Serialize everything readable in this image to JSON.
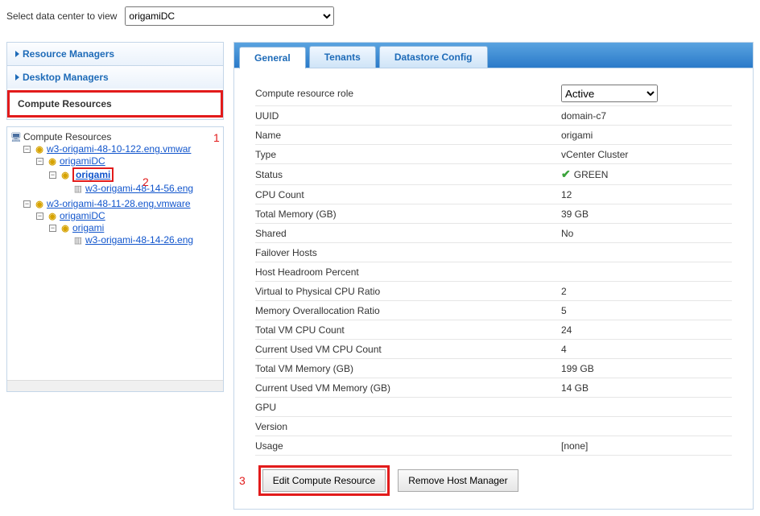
{
  "top": {
    "label": "Select data center to view",
    "selected": "origamiDC"
  },
  "nav": {
    "resource_managers": "Resource Managers",
    "desktop_managers": "Desktop Managers",
    "compute_resources": "Compute Resources"
  },
  "annotations": {
    "a1": "1",
    "a2": "2",
    "a3": "3"
  },
  "tree": {
    "root": "Compute Resources",
    "n1": "w3-origami-48-10-122.eng.vmwar",
    "n1_dc": "origamiDC",
    "n1_cl": "origami",
    "n1_host": "w3-origami-48-14-56.eng",
    "n2": "w3-origami-48-11-28.eng.vmware",
    "n2_dc": "origamiDC",
    "n2_cl": "origami",
    "n2_host": "w3-origami-48-14-26.eng"
  },
  "tabs": {
    "general": "General",
    "tenants": "Tenants",
    "datastore": "Datastore Config"
  },
  "details": {
    "role_label": "Compute resource role",
    "role_value": "Active",
    "uuid_label": "UUID",
    "uuid_value": "domain-c7",
    "name_label": "Name",
    "name_value": "origami",
    "type_label": "Type",
    "type_value": "vCenter Cluster",
    "status_label": "Status",
    "status_value": "GREEN",
    "cpu_count_label": "CPU Count",
    "cpu_count_value": "12",
    "total_mem_label": "Total Memory (GB)",
    "total_mem_value": "39 GB",
    "shared_label": "Shared",
    "shared_value": "No",
    "failover_label": "Failover Hosts",
    "failover_value": "",
    "headroom_label": "Host Headroom Percent",
    "headroom_value": "",
    "vpcpu_label": "Virtual to Physical CPU Ratio",
    "vpcpu_value": "2",
    "memover_label": "Memory Overallocation Ratio",
    "memover_value": "5",
    "tvm_cpu_label": "Total VM CPU Count",
    "tvm_cpu_value": "24",
    "cvm_cpu_label": "Current Used VM CPU Count",
    "cvm_cpu_value": "4",
    "tvm_mem_label": "Total VM Memory (GB)",
    "tvm_mem_value": "199 GB",
    "cvm_mem_label": "Current Used VM Memory (GB)",
    "cvm_mem_value": "14 GB",
    "gpu_label": "GPU",
    "gpu_value": "",
    "version_label": "Version",
    "version_value": "",
    "usage_label": "Usage",
    "usage_value": "[none]"
  },
  "buttons": {
    "edit": "Edit Compute Resource",
    "remove": "Remove Host Manager"
  }
}
